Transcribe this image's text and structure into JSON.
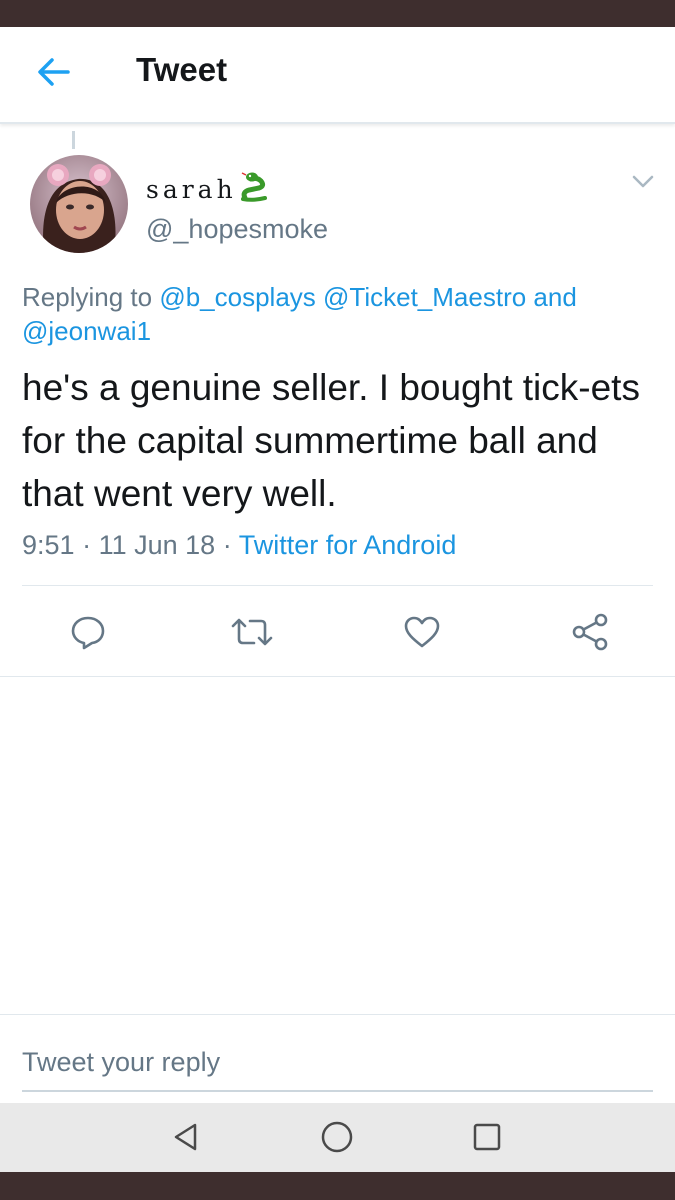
{
  "header": {
    "title": "Tweet",
    "back_icon": "arrow-left-icon",
    "accent_color": "#1da1f2"
  },
  "tweet": {
    "author": {
      "display_name": "sarah",
      "name_emoji": "snake-emoji",
      "handle": "@_hopesmoke"
    },
    "replying_prefix": "Replying to",
    "replying_to": [
      "@b_cosplays",
      "@Ticket_Maestro"
    ],
    "replying_and": "and",
    "replying_last": "@jeonwai1",
    "text": "he's a genuine seller. I bought tick-ets for the capital summertime ball and that went very well.",
    "time": "9:51",
    "date": "11 Jun 18",
    "separator": "·",
    "source": "Twitter for Android",
    "link_color": "#1b95e0"
  },
  "actions": {
    "reply_icon": "reply-icon",
    "retweet_icon": "retweet-icon",
    "like_icon": "heart-icon",
    "share_icon": "share-icon"
  },
  "compose": {
    "placeholder": "Tweet your reply"
  },
  "nav": {
    "back_icon": "triangle-back-icon",
    "home_icon": "circle-home-icon",
    "recents_icon": "square-recents-icon"
  }
}
